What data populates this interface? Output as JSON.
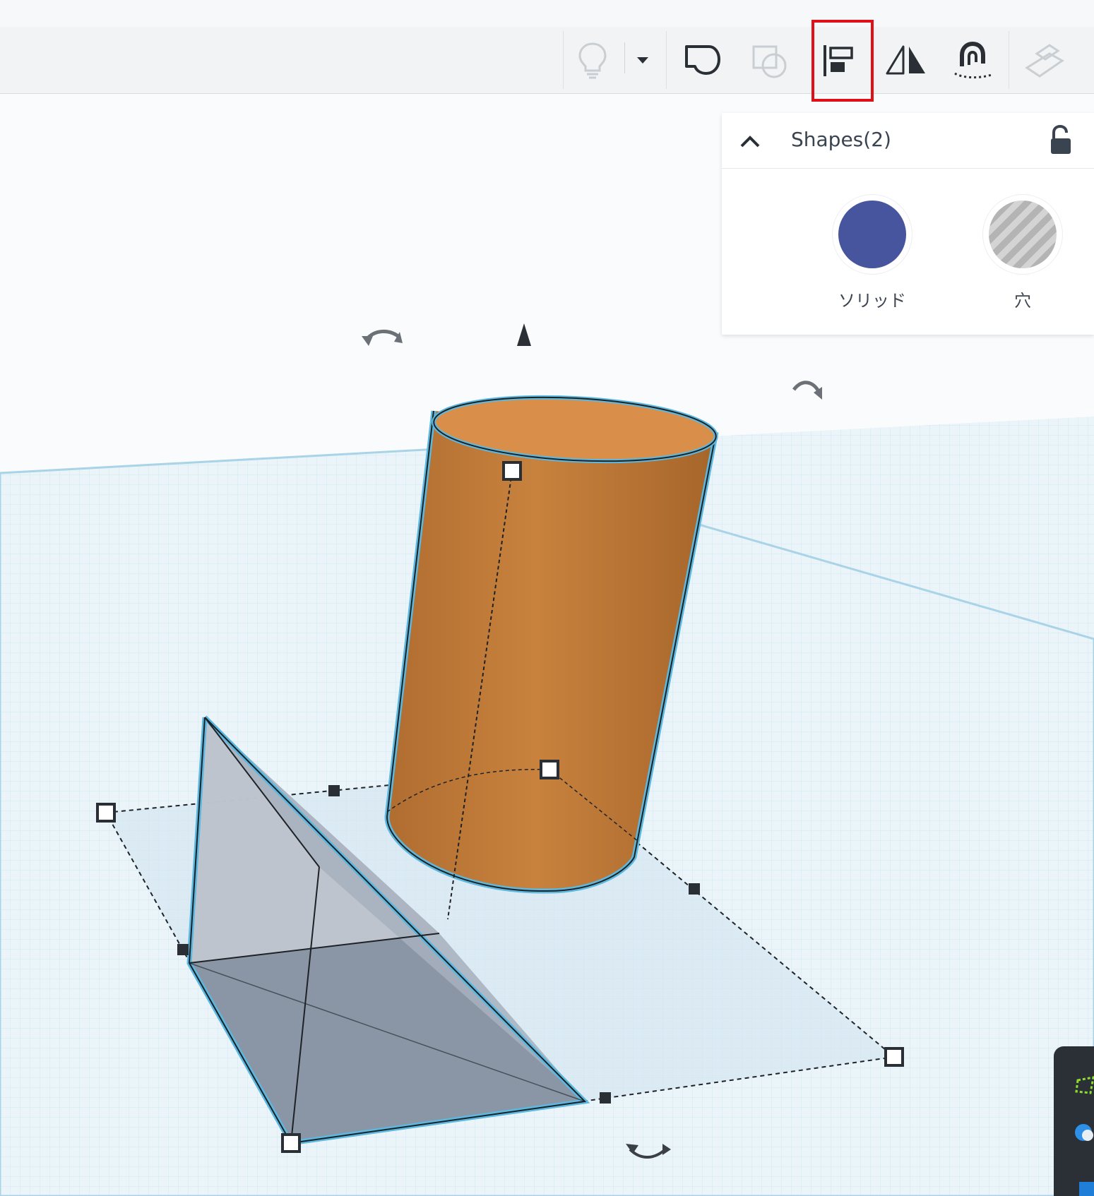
{
  "toolbar": {
    "buttons": [
      {
        "name": "lightbulb-icon",
        "state": "disabled"
      },
      {
        "name": "dropdown-arrow-icon",
        "state": "enabled"
      },
      {
        "name": "group-icon",
        "state": "enabled"
      },
      {
        "name": "ungroup-icon",
        "state": "disabled"
      },
      {
        "name": "align-icon",
        "state": "highlighted"
      },
      {
        "name": "mirror-icon",
        "state": "enabled"
      },
      {
        "name": "cruise-magnet-icon",
        "state": "enabled"
      },
      {
        "name": "workplane-ruler-icon",
        "state": "disabled"
      }
    ],
    "highlight_color": "#e0101a"
  },
  "shapes_panel": {
    "title": "Shapes(2)",
    "solid_label": "ソリッド",
    "hole_label": "穴",
    "solid_color": "#46559e"
  },
  "scene": {
    "cylinder_color": "#c8823e",
    "selection_color": "#5bb8e0",
    "grid_color": "#dbedf6"
  }
}
